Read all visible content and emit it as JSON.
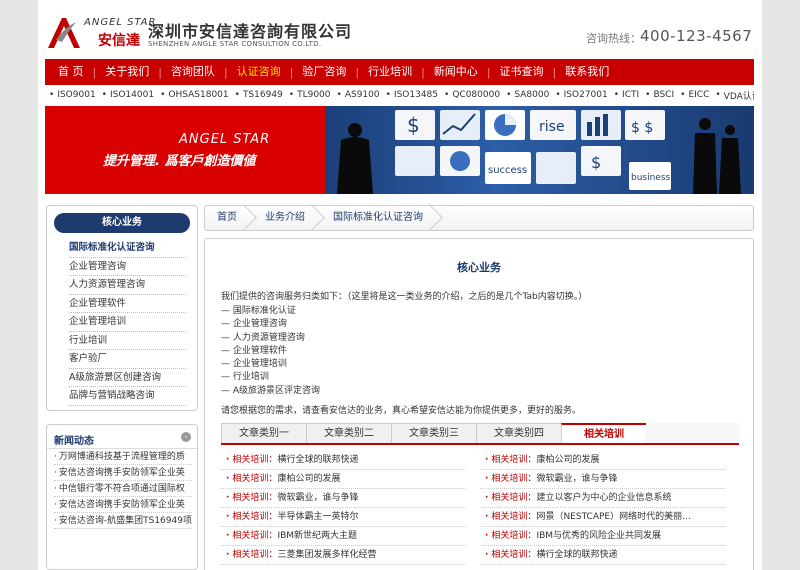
{
  "header": {
    "logo_en": "ANGEL STAR",
    "logo_cn": "安信達",
    "company_cn": "深圳市安信達咨詢有限公司",
    "company_en": "SHENZHEN ANGLE STAR CONSULTION CO.LTD.",
    "hotline_label": "咨询热线：",
    "hotline_number": "400-123-4567"
  },
  "nav": {
    "items": [
      "首 页",
      "关于我们",
      "咨询团队",
      "认证咨询",
      "验厂咨询",
      "行业培训",
      "新闻中心",
      "证书查询",
      "联系我们"
    ]
  },
  "standards": [
    "ISO9001",
    "ISO14001",
    "OHSAS18001",
    "TS16949",
    "TL9000",
    "AS9100",
    "ISO13485",
    "QC080000",
    "SA8000",
    "ISO27001",
    "ICTI",
    "BSCI",
    "EICC",
    "VDA认证咨询"
  ],
  "banner": {
    "brand": "ANGEL STAR",
    "slogan": "提升管理. 爲客戶創造價値",
    "words": [
      "rise",
      "success",
      "business"
    ]
  },
  "sidebar": {
    "title": "核心业务",
    "items": [
      "国际标准化认证咨询",
      "企业管理咨询",
      "人力资源管理咨询",
      "企业管理软件",
      "企业管理培训",
      "行业培训",
      "客户验厂",
      "A级旅游景区创建咨询",
      "品牌与营销战略咨询"
    ]
  },
  "news": {
    "title": "新闻动态",
    "items": [
      "万网博通科技基于流程管理的质",
      "安信达咨询携手安防领军企业英",
      "中信银行零不符合项通过国际权",
      "安信达咨询携手安防领军企业英",
      "安信达咨询-航盛集团TS16949项"
    ]
  },
  "breadcrumb": [
    "首页",
    "业务介绍",
    "国际标准化认证咨询"
  ],
  "main": {
    "title": "核心业务",
    "intro": "我们提供的咨询服务归类如下：（这里将是这一类业务的介绍，之后的是几个Tab内容切换。）",
    "services": [
      "国际标准化认证",
      "企业管理咨询",
      "人力资源管理咨询",
      "企业管理软件",
      "企业管理培训",
      "行业培训",
      "A级旅游景区评定咨询"
    ],
    "closing": "请您根据您的需求，请查看安信达的业务，真心希望安信达能为你提供更多，更好的服务。",
    "tabs": [
      "文章类别一",
      "文章类别二",
      "文章类别三",
      "文章类别四",
      "相关培训"
    ],
    "articles": [
      {
        "prefix": "相关培训：",
        "title": "横行全球的联邦快递"
      },
      {
        "prefix": "相关培训：",
        "title": "康柏公司的发展"
      },
      {
        "prefix": "相关培训：",
        "title": "康柏公司的发展"
      },
      {
        "prefix": "相关培训：",
        "title": "微软霸业，谁与争锋"
      },
      {
        "prefix": "相关培训：",
        "title": "微软霸业，谁与争锋"
      },
      {
        "prefix": "相关培训：",
        "title": "建立以客户为中心的企业信息系统"
      },
      {
        "prefix": "相关培训：",
        "title": "半导体霸主一英特尔"
      },
      {
        "prefix": "相关培训：",
        "title": "网景（NESTCAPE）网络时代的美丽..."
      },
      {
        "prefix": "相关培训：",
        "title": "IBM新世纪两大主题"
      },
      {
        "prefix": "相关培训：",
        "title": "IBM与优秀的风险企业共同发展"
      },
      {
        "prefix": "相关培训：",
        "title": "三菱集团发展多样化经营"
      },
      {
        "prefix": "相关培训：",
        "title": "横行全球的联邦快递"
      }
    ]
  },
  "colors": {
    "brand_red": "#c80000",
    "navy": "#1e3a6e",
    "nav_active": "#ffe000"
  }
}
